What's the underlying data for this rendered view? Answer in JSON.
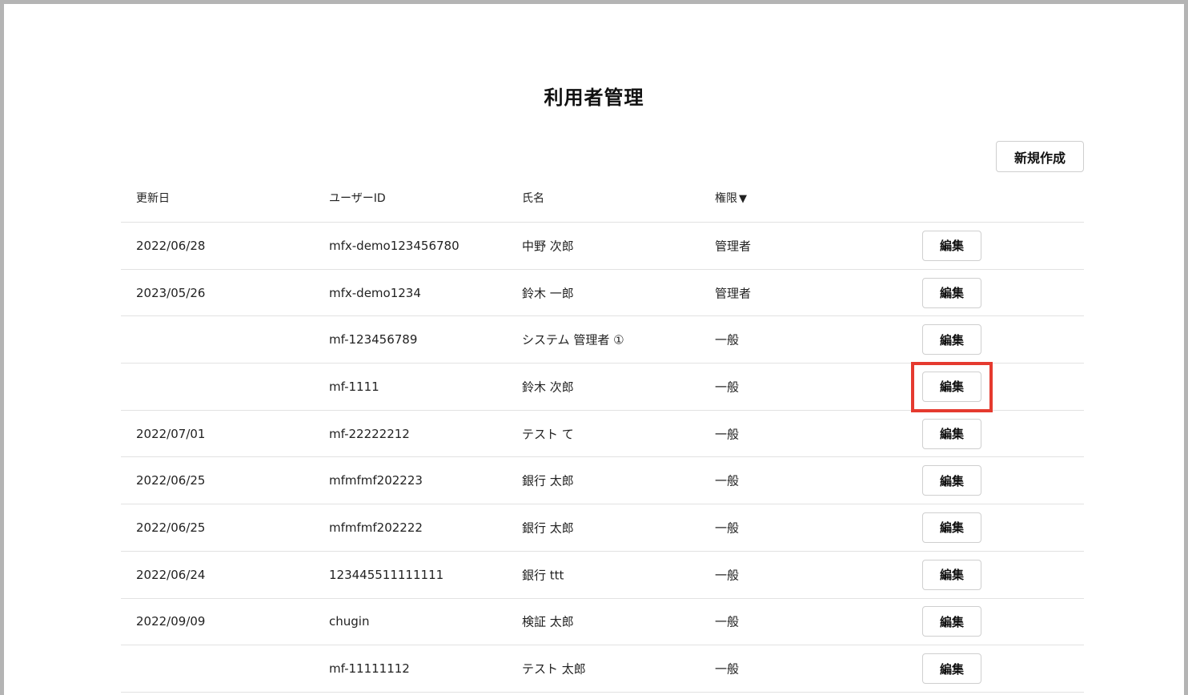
{
  "page": {
    "title": "利用者管理"
  },
  "toolbar": {
    "new_label": "新規作成"
  },
  "table": {
    "headers": {
      "updated": "更新日",
      "user_id": "ユーザーID",
      "name": "氏名",
      "role": "権限",
      "sort_indicator": "▼"
    },
    "edit_label": "編集",
    "rows": [
      {
        "updated": "2022/06/28",
        "user_id": "mfx-demo123456780",
        "name": "中野 次郎",
        "role": "管理者"
      },
      {
        "updated": "2023/05/26",
        "user_id": "mfx-demo1234",
        "name": "鈴木 一郎",
        "role": "管理者"
      },
      {
        "updated": "",
        "user_id": "mf-123456789",
        "name": "システム 管理者 ①",
        "role": "一般"
      },
      {
        "updated": "",
        "user_id": "mf-1111",
        "name": "鈴木 次郎",
        "role": "一般"
      },
      {
        "updated": "2022/07/01",
        "user_id": "mf-22222212",
        "name": "テスト て",
        "role": "一般"
      },
      {
        "updated": "2022/06/25",
        "user_id": "mfmfmf202223",
        "name": "銀行 太郎",
        "role": "一般"
      },
      {
        "updated": "2022/06/25",
        "user_id": "mfmfmf202222",
        "name": "銀行 太郎",
        "role": "一般"
      },
      {
        "updated": "2022/06/24",
        "user_id": "123445511111111",
        "name": "銀行 ttt",
        "role": "一般"
      },
      {
        "updated": "2022/09/09",
        "user_id": "chugin",
        "name": "検証 太郎",
        "role": "一般"
      },
      {
        "updated": "",
        "user_id": "mf-11111112",
        "name": "テスト 太郎",
        "role": "一般"
      }
    ]
  },
  "colors": {
    "highlight": "#e53a2f",
    "border": "#cfcfcf",
    "frame": "#b4b4b4"
  }
}
